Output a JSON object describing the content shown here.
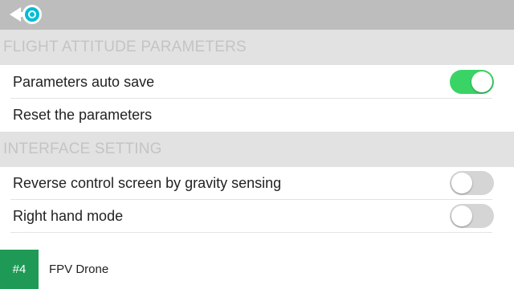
{
  "header": {
    "back_icon": "back-arrow-circle-icon",
    "accent_color": "#00bcd4"
  },
  "sections": [
    {
      "title": "FLIGHT ATTITUDE PARAMETERS",
      "rows": [
        {
          "label": "Parameters auto save",
          "toggle": true,
          "on": true
        },
        {
          "label": "Reset the parameters",
          "toggle": false
        }
      ]
    },
    {
      "title": "INTERFACE SETTING",
      "rows": [
        {
          "label": "Reverse control screen by gravity sensing",
          "toggle": true,
          "on": false
        },
        {
          "label": "Right hand mode",
          "toggle": true,
          "on": false
        }
      ]
    }
  ],
  "footer": {
    "rank": "#4",
    "app_name": "FPV Drone",
    "badge_color": "#1e9a56"
  },
  "colors": {
    "switch_on": "#3ad466",
    "switch_off": "#d5d5d5",
    "header_bar": "#bdbdbd",
    "section_bg": "#e2e2e2"
  }
}
